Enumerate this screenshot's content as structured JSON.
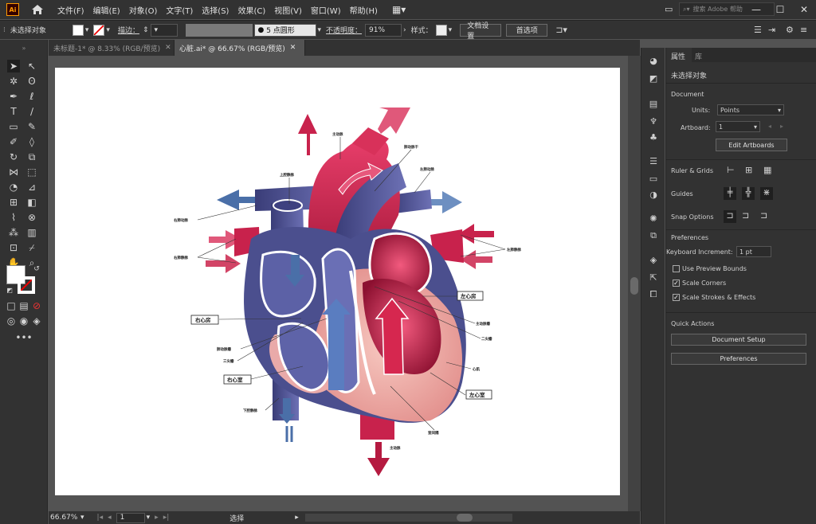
{
  "menubar": {
    "logo": "Ai",
    "items": [
      "文件(F)",
      "编辑(E)",
      "对象(O)",
      "文字(T)",
      "选择(S)",
      "效果(C)",
      "视图(V)",
      "窗口(W)",
      "帮助(H)"
    ],
    "search_placeholder": "搜索 Adobe 帮助"
  },
  "control": {
    "no_selection": "未选择对象",
    "stroke_label": "描边：",
    "brush": "5 点圆形",
    "opacity_label": "不透明度：",
    "opacity": "91%",
    "style_label": "样式：",
    "doc_setup": "文档设置",
    "prefs": "首选项"
  },
  "tabs": [
    {
      "label": "未标题-1* @ 8.33% (RGB/预览)"
    },
    {
      "label": "心脏.ai* @ 66.67% (RGB/预览)"
    }
  ],
  "status": {
    "zoom": "66.67%",
    "artboard": "1",
    "tool": "选择"
  },
  "panel": {
    "tab_properties": "属性",
    "tab_library": "库",
    "no_selection": "未选择对象",
    "document": "Document",
    "units_label": "Units:",
    "units": "Points",
    "artboard_label": "Artboard:",
    "artboard": "1",
    "edit_artboards": "Edit Artboards",
    "ruler_grids": "Ruler & Grids",
    "guides": "Guides",
    "snap": "Snap Options",
    "preferences": "Preferences",
    "kbd_label": "Keyboard Increment:",
    "kbd": "1 pt",
    "use_preview": "Use Preview Bounds",
    "scale_corners": "Scale Corners",
    "scale_strokes": "Scale Strokes & Effects",
    "quick_actions": "Quick Actions",
    "doc_setup": "Document Setup",
    "prefs_btn": "Preferences"
  },
  "heart": {
    "aorta_top": "主动脉",
    "pulmonary_trunk": "肺动脉干",
    "left_pa": "左肺动脉",
    "svc": "上腔静脉",
    "right_pa": "右肺动脉",
    "right_pv": "右肺静脉",
    "left_pv": "左肺静脉",
    "left_atrium": "左心房",
    "aortic_valve": "主动脉瓣",
    "mitral": "二尖瓣",
    "right_atrium": "右心房",
    "pulm_valve": "肺动脉瓣",
    "tricuspid": "三尖瓣",
    "myocardium": "心肌",
    "right_ventricle": "右心室",
    "left_ventricle": "左心室",
    "ivc": "下腔静脉",
    "septum": "室间隔",
    "aorta_bottom": "主动脉"
  },
  "colors": {
    "accent": "#ff9a00",
    "oxygenated": "#c8224c",
    "deoxygenated": "#4b4f8e"
  },
  "icons": [
    "home-icon",
    "select-icon",
    "direct-select-icon",
    "pen-icon",
    "type-icon",
    "rectangle-icon",
    "rotate-icon",
    "hand-icon",
    "zoom-icon",
    "layers-icon"
  ]
}
